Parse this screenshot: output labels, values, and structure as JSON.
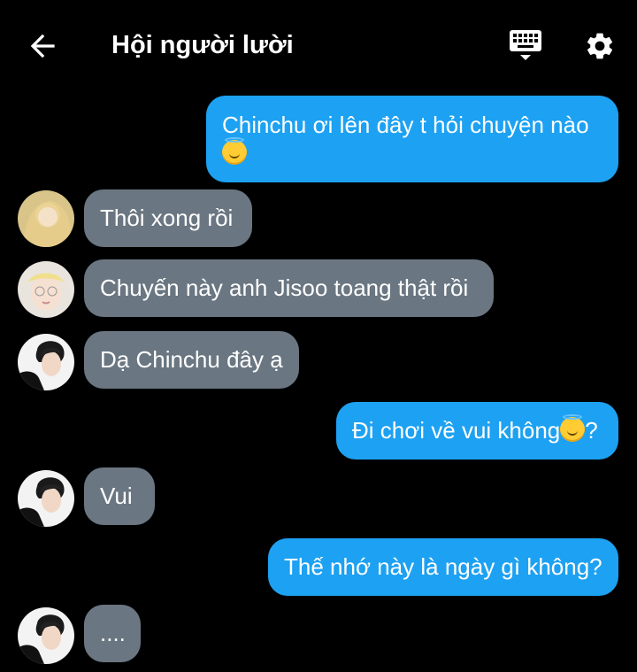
{
  "header": {
    "title": "Hội người lười",
    "back_icon": "arrow-left-icon",
    "keyboard_icon": "keyboard-icon",
    "settings_icon": "gear-icon"
  },
  "colors": {
    "background": "#000000",
    "outgoing_bubble": "#1da1f2",
    "incoming_bubble": "#6a7681",
    "text": "#ffffff"
  },
  "messages": [
    {
      "direction": "outgoing",
      "line1": "Chinchu ơi lên đây t hỏi chuyện nào",
      "emoji": "smiling-face-with-halo"
    },
    {
      "direction": "incoming",
      "text": "Thôi xong rồi",
      "avatar": "avatar-blonde-hair"
    },
    {
      "direction": "incoming",
      "text": "Chuyến này anh Jisoo toang thật rồi",
      "avatar": "avatar-blonde-glasses"
    },
    {
      "direction": "incoming",
      "text": "Dạ Chinchu đây ạ",
      "avatar": "avatar-dark-hair"
    },
    {
      "direction": "outgoing",
      "text_before": "Đi chơi về vui không",
      "emoji": "smiling-face-with-halo",
      "text_after": "?"
    },
    {
      "direction": "incoming",
      "text": "Vui",
      "avatar": "avatar-dark-hair"
    },
    {
      "direction": "outgoing",
      "text": "Thế nhớ này là ngày gì không?"
    },
    {
      "direction": "incoming",
      "text": "....",
      "avatar": "avatar-dark-hair"
    }
  ]
}
